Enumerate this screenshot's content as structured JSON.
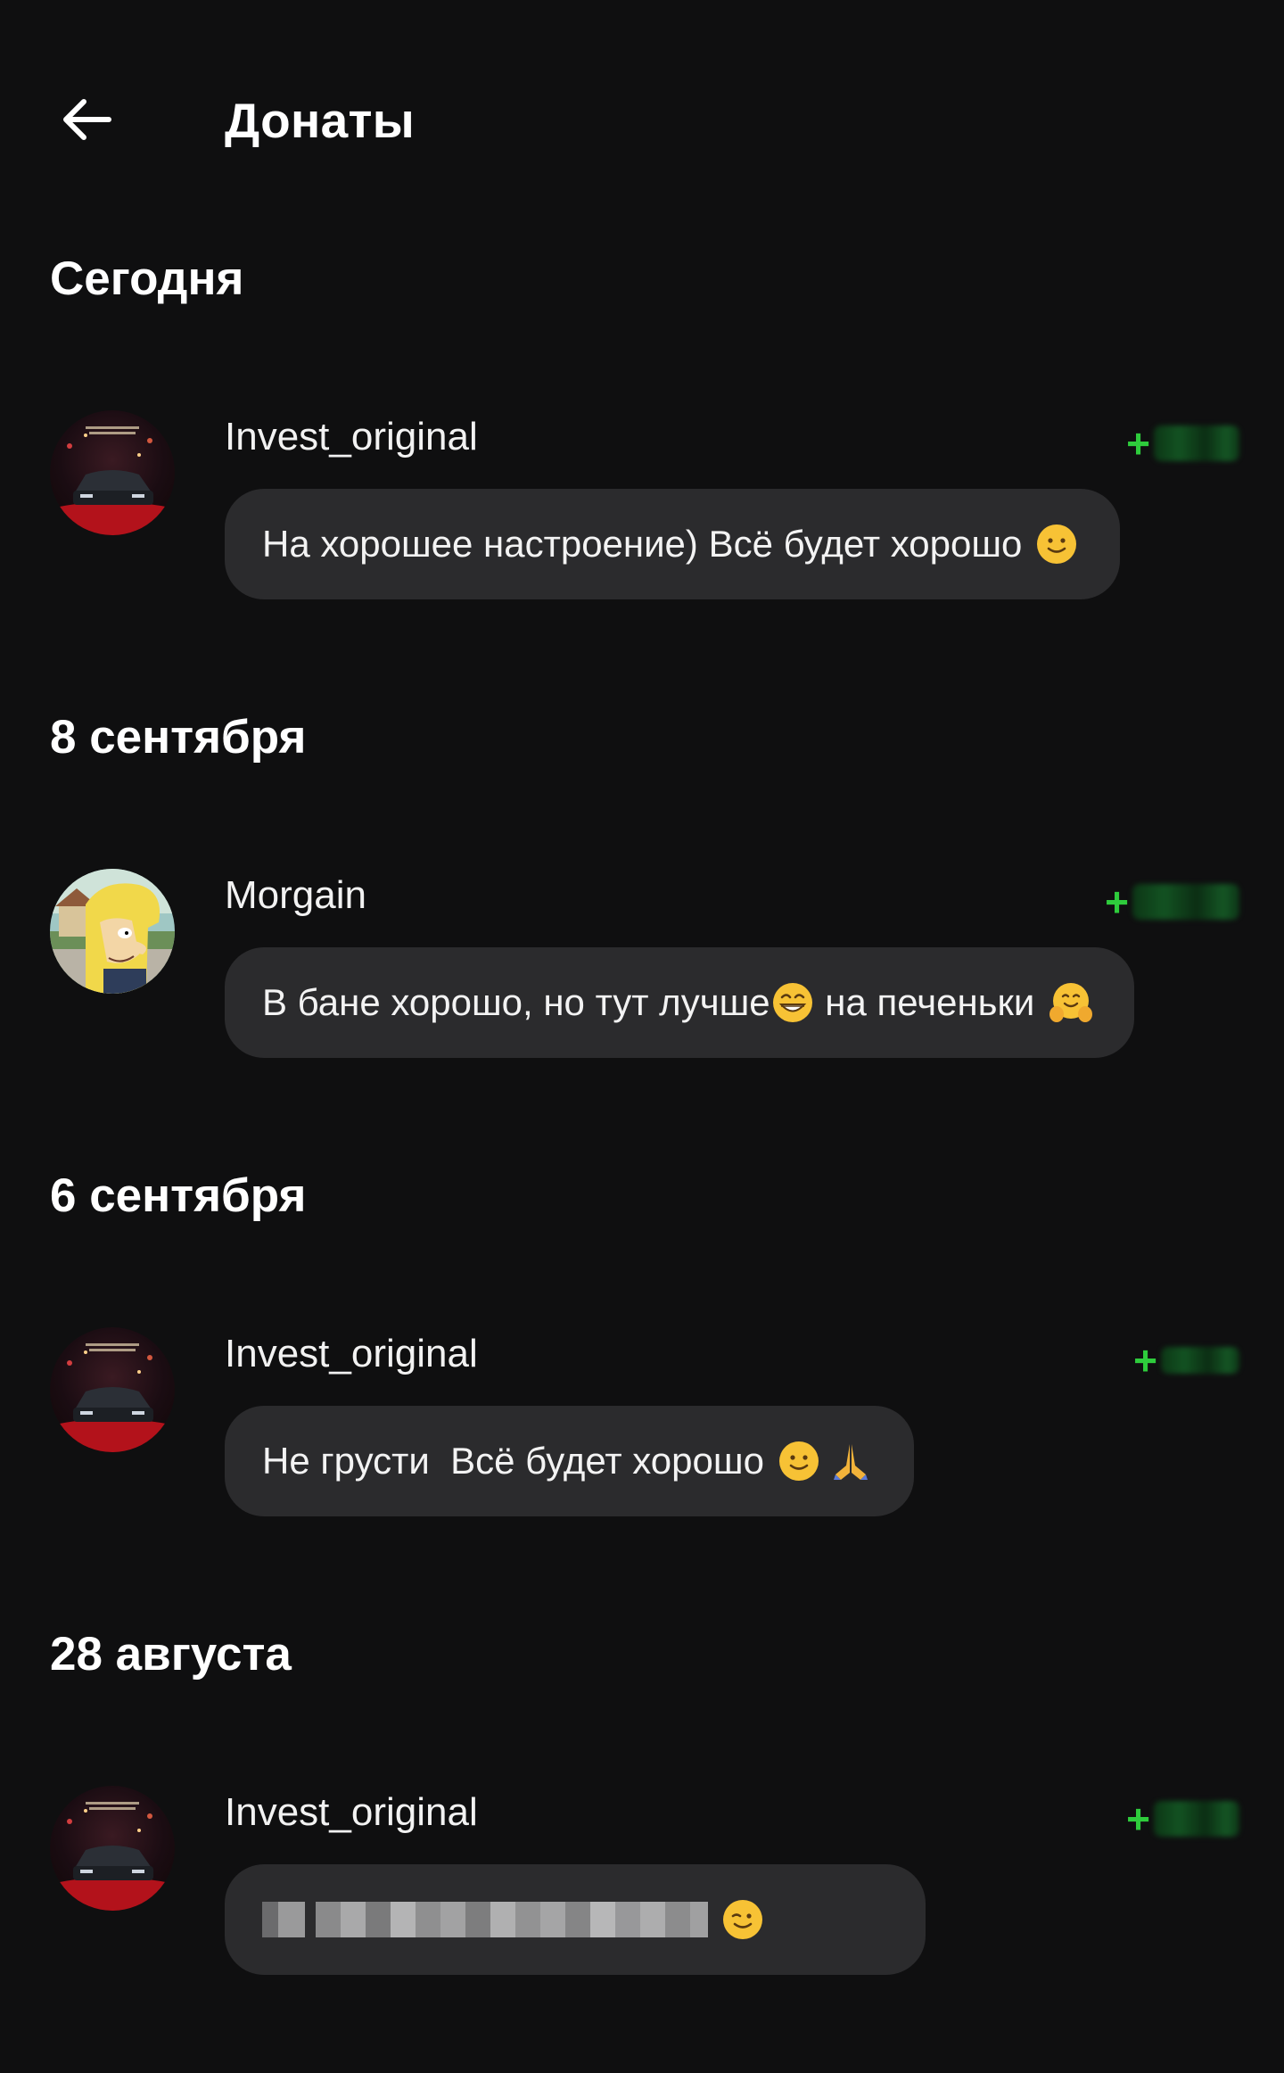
{
  "header": {
    "title": "Донаты",
    "back_icon": "arrow-left-icon"
  },
  "sections": [
    {
      "date": "Сегодня",
      "donation": {
        "username": "Invest_original",
        "amount_sign": "+",
        "message": "На хорошее настроение) Всё будет хорошо",
        "emojis": [
          "slightly-smiling-face-emoji"
        ]
      }
    },
    {
      "date": "8 сентября",
      "donation": {
        "username": "Morgain",
        "amount_sign": "+",
        "message_part1": "В бане хорошо, но тут лучше",
        "message_part2": " на печеньки ",
        "emojis": [
          "grinning-face-emoji",
          "hugging-face-emoji"
        ]
      }
    },
    {
      "date": "6 сентября",
      "donation": {
        "username": "Invest_original",
        "amount_sign": "+",
        "message": "Не грусти  Всё будет хорошо",
        "emojis": [
          "slightly-smiling-face-emoji",
          "folded-hands-emoji"
        ]
      }
    },
    {
      "date": "28 августа",
      "donation": {
        "username": "Invest_original",
        "amount_sign": "+",
        "message_hidden": "pixelated",
        "emojis": [
          "winking-face-emoji"
        ]
      }
    }
  ],
  "colors": {
    "background": "#0f0f10",
    "bubble": "#2b2b2d",
    "amount_plus": "#2ecc3c",
    "text": "#ffffff"
  }
}
